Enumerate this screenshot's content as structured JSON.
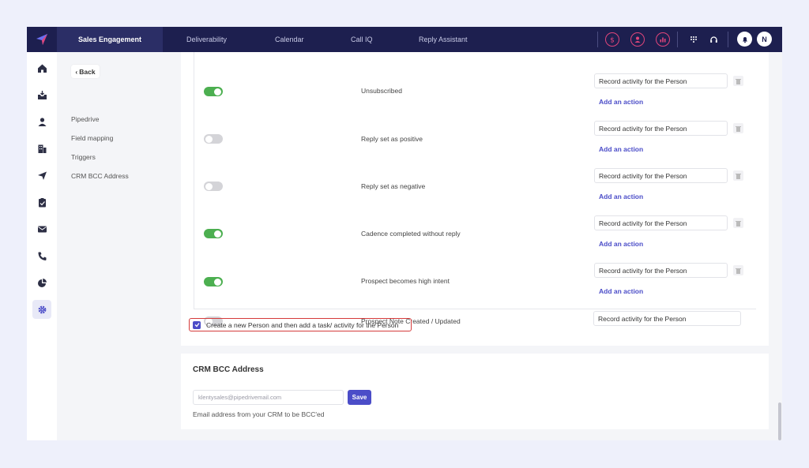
{
  "nav": {
    "active": "Sales Engagement",
    "links": [
      "Deliverability",
      "Calendar",
      "Call IQ",
      "Reply Assistant"
    ],
    "avatar_initial": "N"
  },
  "subnav": {
    "back": "Back",
    "items": [
      "Pipedrive",
      "Field mapping",
      "Triggers",
      "CRM BCC Address"
    ]
  },
  "triggers": [
    {
      "label": "Unsubscribed",
      "enabled": true,
      "action": "Record activity for the Person",
      "add_action": "Add an action"
    },
    {
      "label": "Reply set as positive",
      "enabled": false,
      "action": "Record activity for the Person",
      "add_action": "Add an action"
    },
    {
      "label": "Reply set as negative",
      "enabled": false,
      "action": "Record activity for the Person",
      "add_action": "Add an action"
    },
    {
      "label": "Cadence completed without reply",
      "enabled": true,
      "action": "Record activity for the Person",
      "add_action": "Add an action"
    },
    {
      "label": "Prospect becomes high intent",
      "enabled": true,
      "action": "Record activity for the Person",
      "add_action": "Add an action"
    },
    {
      "label": "Prospect Note Created / Updated",
      "enabled": false,
      "action": "Record activity for the Person"
    }
  ],
  "create_person": {
    "checked": true,
    "label": "Create a new Person and then add a task/ activity for the Person"
  },
  "bcc": {
    "title": "CRM BCC Address",
    "value": "klentysales@pipedrivemail.com",
    "save": "Save",
    "help": "Email address from your CRM to be BCC'ed"
  },
  "colors": {
    "nav_bg": "#1d1f4f",
    "accent": "#4b4dc8",
    "toggle_on": "#4caf50",
    "highlight": "#d53b3b"
  }
}
